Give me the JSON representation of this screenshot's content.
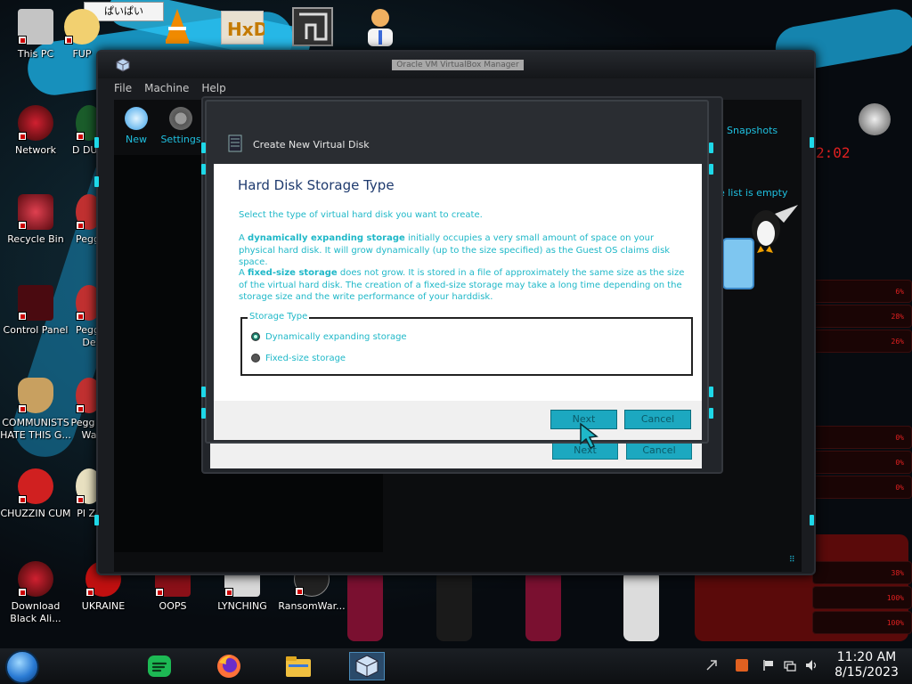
{
  "desktop": {
    "icons": [
      {
        "label": "This PC"
      },
      {
        "label": "FUP"
      },
      {
        "label": "Network"
      },
      {
        "label": "D DUM"
      },
      {
        "label": "Recycle Bin"
      },
      {
        "label": "Peggl"
      },
      {
        "label": "Control Panel"
      },
      {
        "label": "Peggl De"
      },
      {
        "label": "COMMUNISTS HATE THIS G..."
      },
      {
        "label": "Pegg of Wa"
      },
      {
        "label": "CHUZZIN CUM"
      },
      {
        "label": "Pl Zo"
      },
      {
        "label": "Download Black Ali..."
      },
      {
        "label": "UKRAINE"
      },
      {
        "label": "OOPS"
      },
      {
        "label": "LYNCHING"
      },
      {
        "label": "RansomWar..."
      }
    ],
    "sticky_note": "ぱいぱい"
  },
  "gadgets": {
    "clock": "2:02",
    "values": [
      "6%",
      "28%",
      "26%",
      "0%",
      "0%",
      "0%",
      "38%",
      "100%",
      "100%"
    ]
  },
  "vbox": {
    "title": "Oracle VM VirtualBox Manager",
    "menu": [
      "File",
      "Machine",
      "Help"
    ],
    "toolbar": [
      {
        "label": "New"
      },
      {
        "label": "Settings"
      }
    ],
    "snapshots": "Snapshots",
    "empty": "he list is empty"
  },
  "wizard_back": {
    "next": "Next",
    "cancel": "Cancel"
  },
  "dialog": {
    "title": "Create New Virtual Disk",
    "heading": "Hard Disk Storage Type",
    "intro": "Select the type of virtual hard disk you want to create.",
    "dynamic_prefix": "A ",
    "dynamic_bold": "dynamically expanding storage",
    "dynamic_rest": " initially occupies a very small amount of space on your physical hard disk. It will grow dynamically (up to the size specified) as the Guest OS claims disk space.",
    "fixed_prefix": "A ",
    "fixed_bold": "fixed-size storage",
    "fixed_rest": " does not grow. It is stored in a file of approximately the same size as the size of the virtual hard disk. The creation of a fixed-size storage may take a long time depending on the storage size and the write performance of your harddisk.",
    "group_label": "Storage Type",
    "options": [
      {
        "label": "Dynamically expanding storage",
        "checked": true
      },
      {
        "label": "Fixed-size storage",
        "checked": false
      }
    ],
    "next": "Next",
    "cancel": "Cancel"
  },
  "taskbar": {
    "time": "11:20 AM",
    "date": "8/15/2023",
    "apps": [
      "spotify-icon",
      "firefox-icon",
      "file-explorer-icon",
      "virtualbox-icon"
    ]
  }
}
